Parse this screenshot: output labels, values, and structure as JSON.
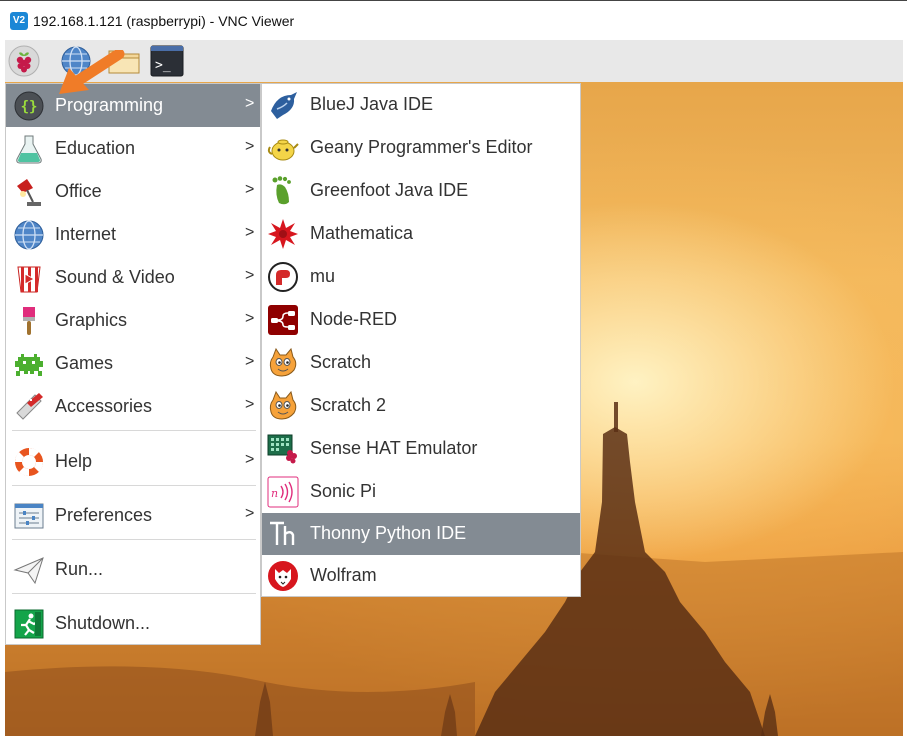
{
  "window": {
    "logo_text": "V2",
    "title": "192.168.1.121 (raspberrypi) - VNC Viewer"
  },
  "taskbar": {
    "icons": [
      "raspberry-icon",
      "globe-icon",
      "folder-icon",
      "terminal-icon"
    ],
    "terminal_glyph": ">_"
  },
  "menu": {
    "arrow_glyph": ">",
    "items": [
      {
        "label": "Programming",
        "icon": "curly-braces-icon",
        "submenu": true,
        "active": true
      },
      {
        "label": "Education",
        "icon": "flask-icon",
        "submenu": true
      },
      {
        "label": "Office",
        "icon": "desk-lamp-icon",
        "submenu": true
      },
      {
        "label": "Internet",
        "icon": "globe-icon",
        "submenu": true
      },
      {
        "label": "Sound & Video",
        "icon": "popcorn-icon",
        "submenu": true
      },
      {
        "label": "Graphics",
        "icon": "paintbrush-icon",
        "submenu": true
      },
      {
        "label": "Games",
        "icon": "space-invader-icon",
        "submenu": true
      },
      {
        "label": "Accessories",
        "icon": "swiss-knife-icon",
        "submenu": true
      },
      {
        "label": "Help",
        "icon": "lifebuoy-icon",
        "submenu": true
      },
      {
        "label": "Preferences",
        "icon": "sliders-icon",
        "submenu": true
      },
      {
        "label": "Run...",
        "icon": "paper-plane-icon",
        "submenu": false
      },
      {
        "label": "Shutdown...",
        "icon": "exit-running-man-icon",
        "submenu": false
      }
    ]
  },
  "submenu": {
    "items": [
      {
        "label": "BlueJ Java IDE",
        "icon": "bluej-bird-icon"
      },
      {
        "label": "Geany Programmer's Editor",
        "icon": "geany-teapot-icon"
      },
      {
        "label": "Greenfoot Java IDE",
        "icon": "greenfoot-icon"
      },
      {
        "label": "Mathematica",
        "icon": "mathematica-star-icon"
      },
      {
        "label": "mu",
        "icon": "mu-icon"
      },
      {
        "label": "Node-RED",
        "icon": "node-red-icon"
      },
      {
        "label": "Scratch",
        "icon": "scratch-cat-icon"
      },
      {
        "label": "Scratch 2",
        "icon": "scratch-cat-icon"
      },
      {
        "label": "Sense HAT Emulator",
        "icon": "sense-hat-icon"
      },
      {
        "label": "Sonic Pi",
        "icon": "sonic-pi-icon"
      },
      {
        "label": "Thonny Python IDE",
        "icon": "thonny-icon",
        "active": true
      },
      {
        "label": "Wolfram",
        "icon": "wolfram-wolf-icon"
      }
    ]
  },
  "colors": {
    "highlight": "#838b93",
    "pointer": "#f07c28",
    "taskbar": "#e8e8e8"
  }
}
